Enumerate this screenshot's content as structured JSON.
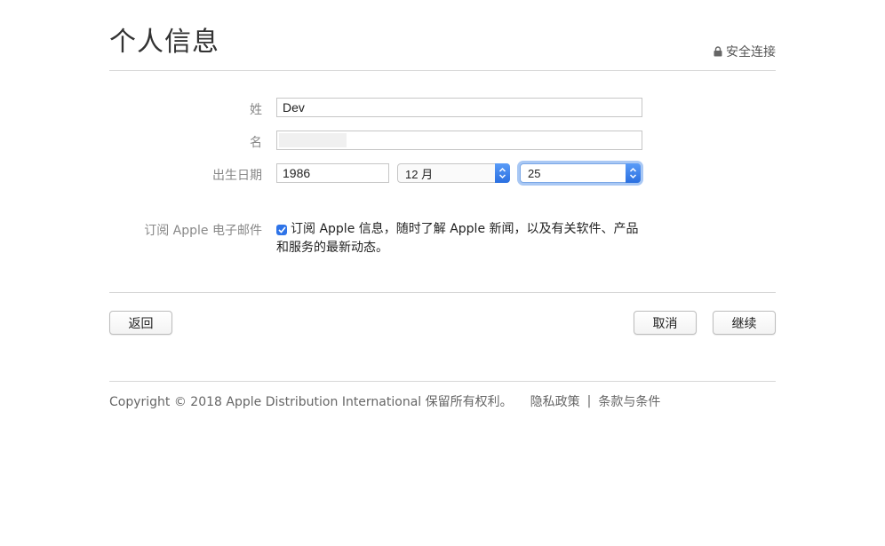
{
  "header": {
    "title": "个人信息",
    "secure_label": "安全连接"
  },
  "form": {
    "last_name_label": "姓",
    "last_name_value": "Dev",
    "first_name_label": "名",
    "first_name_value": "",
    "birthdate_label": "出生日期",
    "birth_year": "1986",
    "birth_month": "12 月",
    "birth_day": "25",
    "subscribe_label": "订阅 Apple 电子邮件",
    "subscribe_text": "订阅 Apple 信息，随时了解 Apple 新闻，以及有关软件、产品和服务的最新动态。",
    "subscribe_checked": true
  },
  "buttons": {
    "back": "返回",
    "cancel": "取消",
    "continue": "继续"
  },
  "footer": {
    "copyright": "Copyright © 2018 Apple Distribution International 保留所有权利。",
    "privacy": "隐私政策",
    "separator": "|",
    "terms": "条款与条件"
  },
  "colors": {
    "accent": "#2f74e8"
  }
}
